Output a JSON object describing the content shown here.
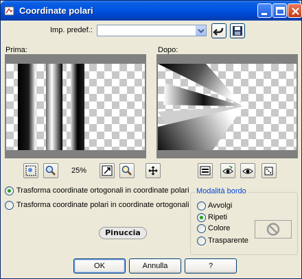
{
  "window": {
    "title": "Coordinate polari"
  },
  "presets": {
    "label": "Imp. predef.:",
    "value": ""
  },
  "preview": {
    "before_label": "Prima:",
    "after_label": "Dopo:",
    "zoom": "25%"
  },
  "transform": {
    "options": [
      {
        "label": "Trasforma coordinate ortogonali in coordinate polari",
        "selected": true
      },
      {
        "label": "Trasforma coordinate polari in coordinate ortogonali",
        "selected": false
      }
    ]
  },
  "edge_mode": {
    "title": "Modalità bordo",
    "options": [
      {
        "label": "Avvolgi",
        "selected": false
      },
      {
        "label": "Ripeti",
        "selected": true
      },
      {
        "label": "Colore",
        "selected": false
      },
      {
        "label": "Trasparente",
        "selected": false
      }
    ]
  },
  "watermark": "Pinuccia",
  "buttons": {
    "ok": "OK",
    "cancel": "Annulla",
    "help": "?"
  },
  "colors": {
    "titlebar": "#0054e3",
    "face": "#ece9d8",
    "accent": "#0046d5",
    "radio_on": "#21a121"
  }
}
